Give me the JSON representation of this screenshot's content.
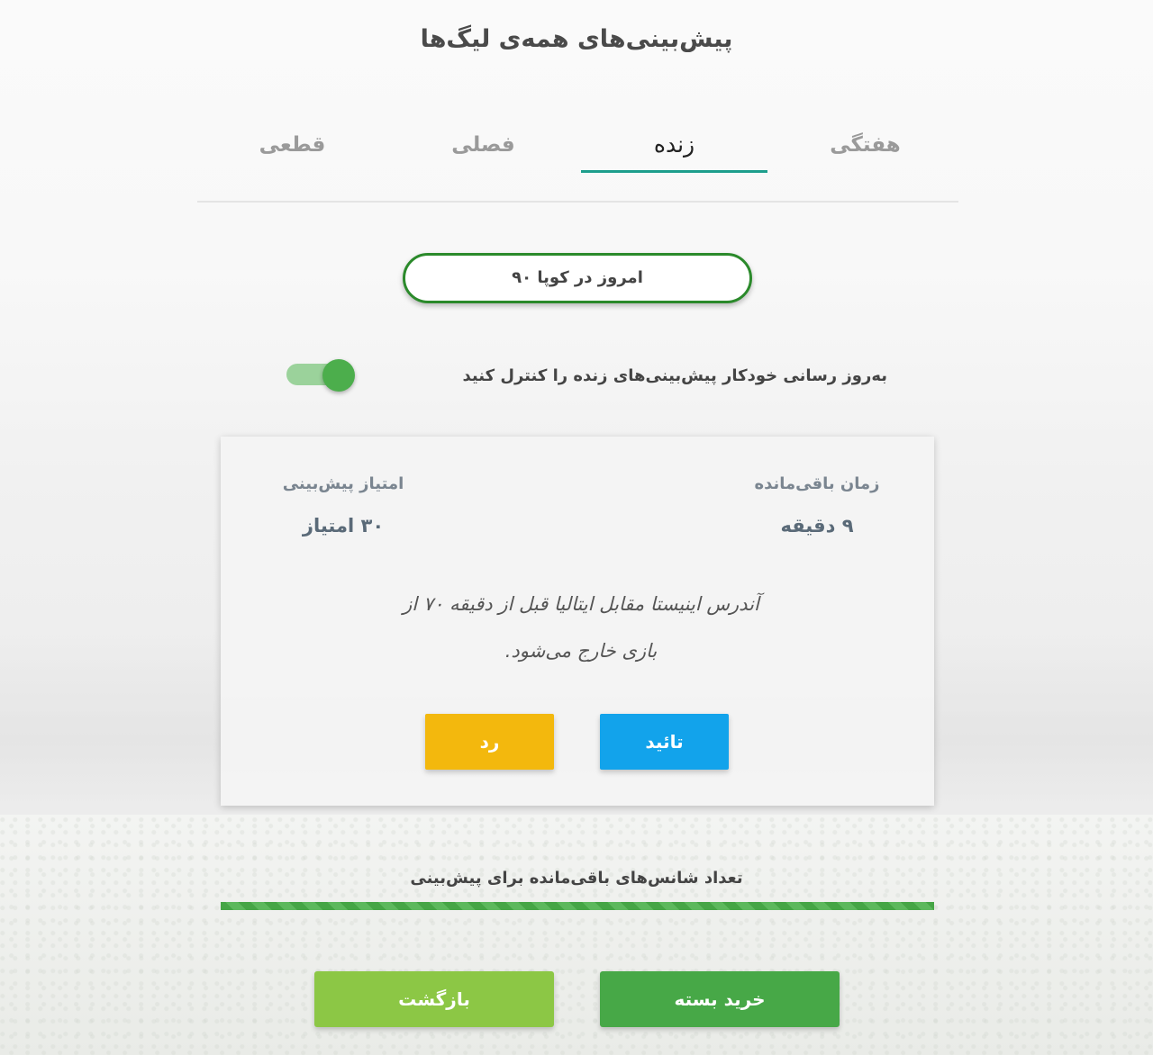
{
  "title": "پیش‌بینی‌های همه‌ی لیگ‌ها",
  "tabs": [
    {
      "label": "هفتگی",
      "active": false
    },
    {
      "label": "زنده",
      "active": true
    },
    {
      "label": "فصلی",
      "active": false
    },
    {
      "label": "قطعی",
      "active": false
    }
  ],
  "today_pill": "امروز در کوپا ۹۰",
  "auto_update": {
    "label": "به‌روز رسانی خودکار پیش‌بینی‌های زنده را کنترل کنید",
    "enabled": true
  },
  "card": {
    "time_label": "زمان باقی‌مانده",
    "time_value": "۹ دقیقه",
    "points_label": "امتیاز پیش‌بینی",
    "points_value": "۳۰ امتیاز",
    "question_line1": "آندرس اینیستا مقابل ایتالیا قبل از دقیقه ۷۰ از",
    "question_line2": "بازی خارج می‌شود.",
    "confirm_label": "تائید",
    "reject_label": "رد"
  },
  "chances": {
    "label": "تعداد شانس‌های باقی‌مانده برای پیش‌بینی",
    "fraction": 1.0
  },
  "buttons": {
    "buy": "خرید بسته",
    "back": "بازگشت"
  },
  "colors": {
    "accent_green": "#47a847",
    "tab_underline": "#1d9e8c",
    "confirm_blue": "#12a3eb",
    "reject_yellow": "#f3b80d",
    "back_lightgreen": "#8cc745"
  }
}
